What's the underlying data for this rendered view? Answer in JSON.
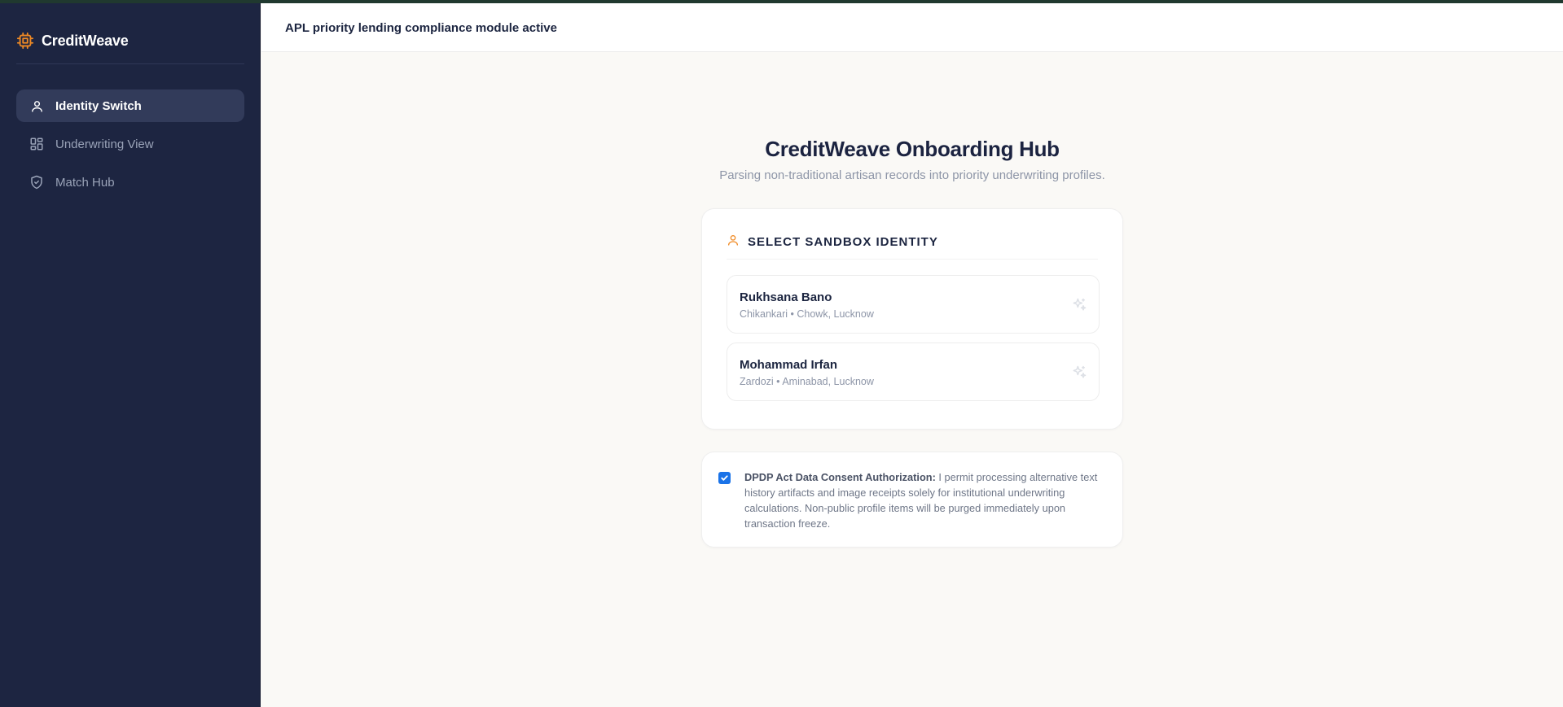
{
  "app": {
    "name": "CreditWeave",
    "logo_icon": "chip-icon",
    "accent_color": "#f08a24",
    "sidebar_color": "#1d2541"
  },
  "sidebar": {
    "items": [
      {
        "label": "Identity Switch",
        "icon": "user-icon",
        "active": true
      },
      {
        "label": "Underwriting View",
        "icon": "dashboard-grid-icon",
        "active": false
      },
      {
        "label": "Match Hub",
        "icon": "shield-check-icon",
        "active": false
      }
    ]
  },
  "header": {
    "status_text": "APL priority lending compliance module active"
  },
  "main": {
    "title": "CreditWeave Onboarding Hub",
    "subtitle": "Parsing non-traditional artisan records into priority underwriting profiles.",
    "identity_card": {
      "title": "SELECT SANDBOX IDENTITY",
      "icon": "user-icon",
      "personas": [
        {
          "name": "Rukhsana Bano",
          "meta": "Chikankari • Chowk, Lucknow",
          "icon": "sparkle-icon"
        },
        {
          "name": "Mohammad Irfan",
          "meta": "Zardozi • Aminabad, Lucknow",
          "icon": "sparkle-icon"
        }
      ]
    },
    "consent": {
      "checked": true,
      "label_bold": "DPDP Act Data Consent Authorization:",
      "label_text": " I permit processing alternative text history artifacts and image receipts solely for institutional underwriting calculations. Non-public profile items will be purged immediately upon transaction freeze."
    }
  }
}
